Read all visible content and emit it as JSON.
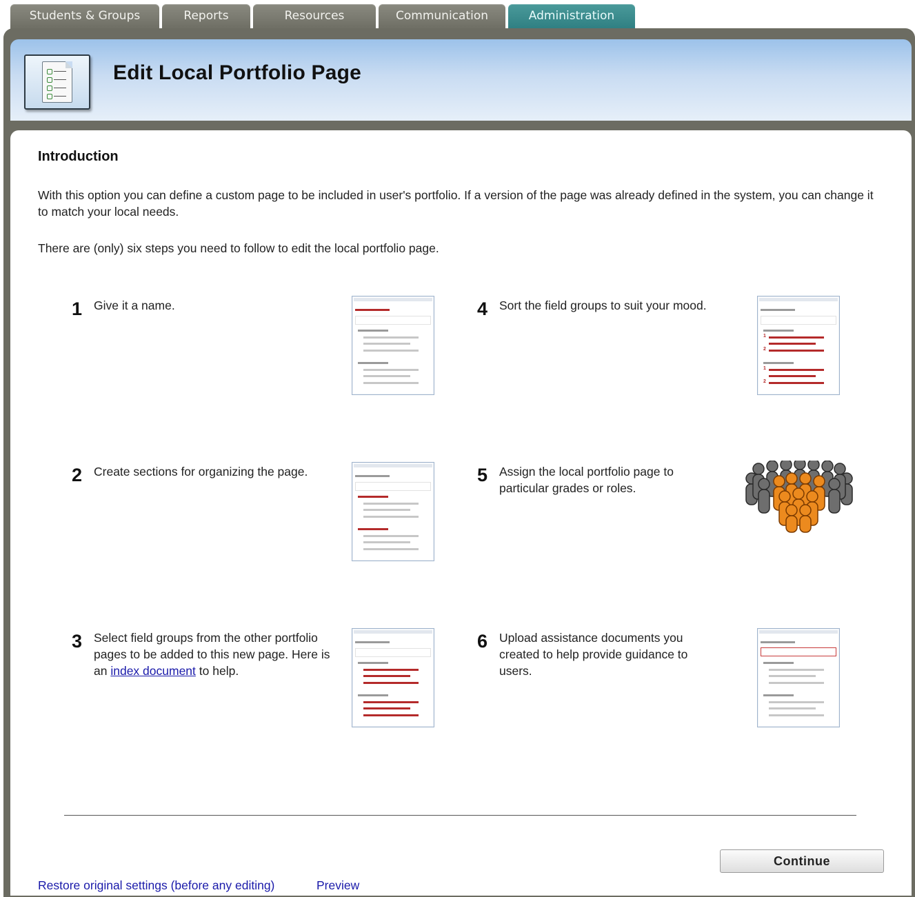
{
  "tabs": [
    {
      "label": "Students & Groups",
      "active": false
    },
    {
      "label": "Reports",
      "active": false
    },
    {
      "label": "Resources",
      "active": false
    },
    {
      "label": "Communication",
      "active": false
    },
    {
      "label": "Administration",
      "active": true
    }
  ],
  "header": {
    "title": "Edit Local Portfolio Page",
    "icon": "checklist-document-icon"
  },
  "intro": {
    "heading": "Introduction",
    "paragraph1": "With this option you can define a custom page to be included in user's portfolio. If a version of the page was already defined in the system, you can change it to match your local needs.",
    "paragraph2": "There are (only) six steps you need to follow to edit the local portfolio page."
  },
  "steps": [
    {
      "number": "1",
      "text": "Give it a name.",
      "thumbnail": "name-field-thumbnail"
    },
    {
      "number": "2",
      "text": "Create sections for organizing the page.",
      "thumbnail": "sections-thumbnail"
    },
    {
      "number": "3",
      "text_before": "Select field groups from the other portfolio pages to be added to this new page. Here is an",
      "link": "index document",
      "text_after": "to help.",
      "thumbnail": "field-groups-thumbnail"
    },
    {
      "number": "4",
      "text": "Sort the field groups to suit your mood.",
      "thumbnail": "sorted-groups-thumbnail"
    },
    {
      "number": "5",
      "text": "Assign the local portfolio page to particular grades or roles.",
      "thumbnail": "people-group-icon"
    },
    {
      "number": "6",
      "text": "Upload assistance documents you created to help provide guidance to users.",
      "thumbnail": "upload-document-thumbnail"
    }
  ],
  "actions": {
    "continue_label": "Continue",
    "restore_label": "Restore original settings (before any editing)",
    "preview_label": "Preview"
  },
  "colors": {
    "active_tab": "#2f7f82",
    "inactive_tab": "#6e6e64",
    "frame": "#6c6c62",
    "header_gradient_top": "#9cc2ea",
    "accent_red": "#b42a2a",
    "people_orange": "#e8841a",
    "people_gray": "#6a6a6a"
  }
}
